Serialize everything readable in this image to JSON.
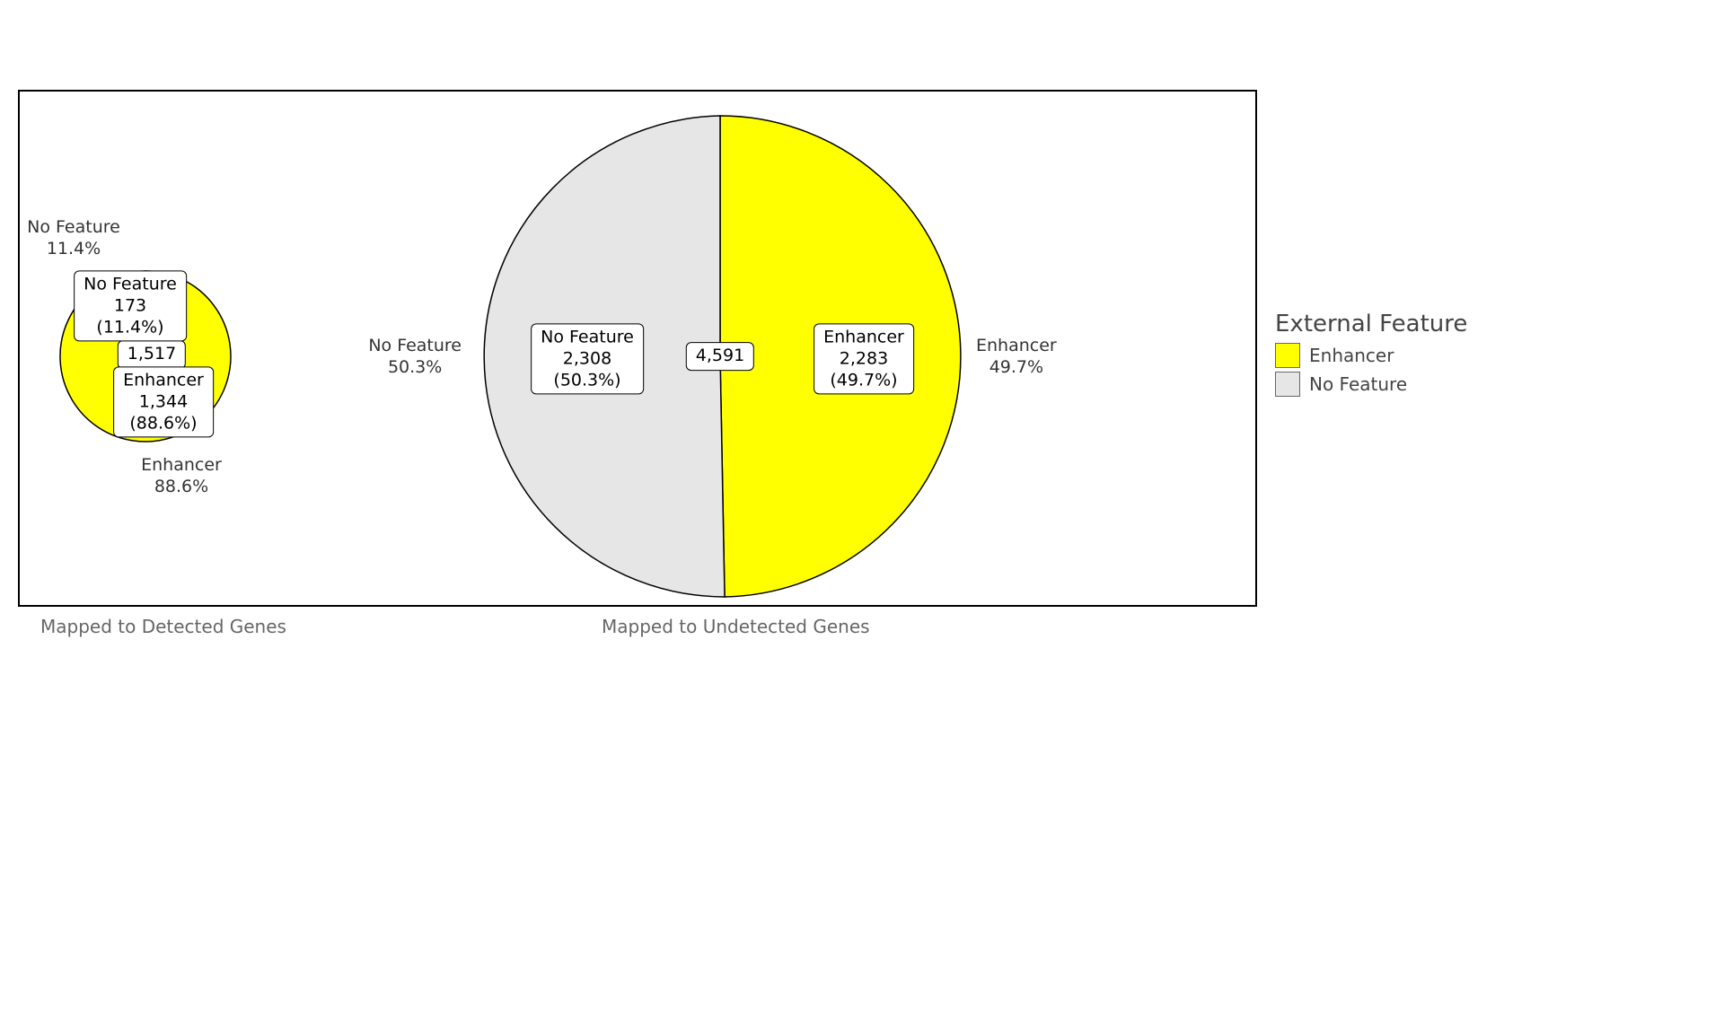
{
  "chart_data": {
    "type": "pie",
    "charts": [
      {
        "title": "Mapped to Detected Genes",
        "total": 1517,
        "slices": [
          {
            "name": "Enhancer",
            "value": 1344,
            "percent": 88.6,
            "color": "#FFFF00"
          },
          {
            "name": "No Feature",
            "value": 173,
            "percent": 11.4,
            "color": "#E6E6E6"
          }
        ]
      },
      {
        "title": "Mapped to Undetected Genes",
        "total": 4591,
        "slices": [
          {
            "name": "Enhancer",
            "value": 2283,
            "percent": 49.7,
            "color": "#FFFF00"
          },
          {
            "name": "No Feature",
            "value": 2308,
            "percent": 50.3,
            "color": "#E6E6E6"
          }
        ]
      }
    ],
    "legend": {
      "title": "External Feature",
      "items": [
        {
          "name": "Enhancer",
          "color": "#FFFF00"
        },
        {
          "name": "No Feature",
          "color": "#E6E6E6"
        }
      ]
    }
  },
  "fmt": {
    "slice_label_0_0": "Enhancer\n1,344\n(88.6%)",
    "slice_label_0_1": "No Feature\n173\n(11.4%)",
    "slice_label_1_0": "Enhancer\n2,283\n(49.7%)",
    "slice_label_1_1": "No Feature\n2,308\n(50.3%)",
    "outer_0_0": "Enhancer\n88.6%",
    "outer_0_1": "No Feature\n11.4%",
    "outer_1_0": "Enhancer\n49.7%",
    "outer_1_1": "No Feature\n50.3%",
    "total_0": "1,517",
    "total_1": "4,591"
  }
}
